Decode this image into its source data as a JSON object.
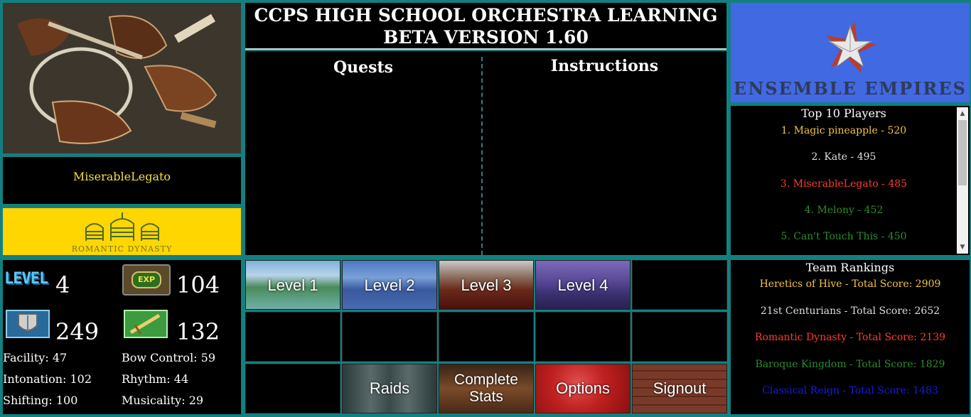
{
  "header": {
    "title_line1": "CCPS HIGH SCHOOL ORCHESTRA LEARNING",
    "title_line2": "BETA VERSION 1.60"
  },
  "player": {
    "name": "MiserableLegato",
    "team_logo_text": "ROMANTIC DYNASTY"
  },
  "stats": {
    "level_label": "LEVEL",
    "exp_label": "EXP",
    "level": "4",
    "exp": "104",
    "defense": "249",
    "attack": "132",
    "facility": "Facility: 47",
    "bow_control": "Bow Control: 59",
    "intonation": "Intonation: 102",
    "rhythm": "Rhythm: 44",
    "shifting": "Shifting: 100",
    "musicality": "Musicality: 29"
  },
  "panels": {
    "quests_title": "Quests",
    "instructions_title": "Instructions"
  },
  "grid": {
    "level1": "Level 1",
    "level2": "Level 2",
    "level3": "Level 3",
    "level4": "Level 4",
    "raids": "Raids",
    "complete_stats_line1": "Complete",
    "complete_stats_line2": "Stats",
    "options": "Options",
    "signout": "Signout"
  },
  "brand": {
    "name": "ENSEMBLE EMPIRES"
  },
  "top10": {
    "title": "Top 10 Players",
    "entries": [
      {
        "text": "1. Magic pineapple - 520",
        "color": "#f5c242"
      },
      {
        "text": "2. Kate - 495",
        "color": "#dddddd"
      },
      {
        "text": "3. MiserableLegato - 485",
        "color": "#ff3b30"
      },
      {
        "text": "4. Melony - 452",
        "color": "#2e8b2e"
      },
      {
        "text": "5. Can't Touch This - 450",
        "color": "#2e8b2e"
      }
    ]
  },
  "teams": {
    "title": "Team Rankings",
    "entries": [
      {
        "text": "Heretics of Hive - Total Score: 2909",
        "color": "#f5c242"
      },
      {
        "text": "21st Centurians - Total Score: 2652",
        "color": "#dddddd"
      },
      {
        "text": "Romantic Dynasty - Total Score: 2139",
        "color": "#ff3b30"
      },
      {
        "text": "Baroque Kingdom - Total Score: 1829",
        "color": "#2e8b2e"
      },
      {
        "text": "Classical Reign - Total Score: 1483",
        "color": "#1a1adb"
      }
    ]
  },
  "colors": {
    "frame": "#128080",
    "gold": "#f2e040",
    "brand_blue": "#4169e1",
    "team_yellow": "#ffd600"
  }
}
